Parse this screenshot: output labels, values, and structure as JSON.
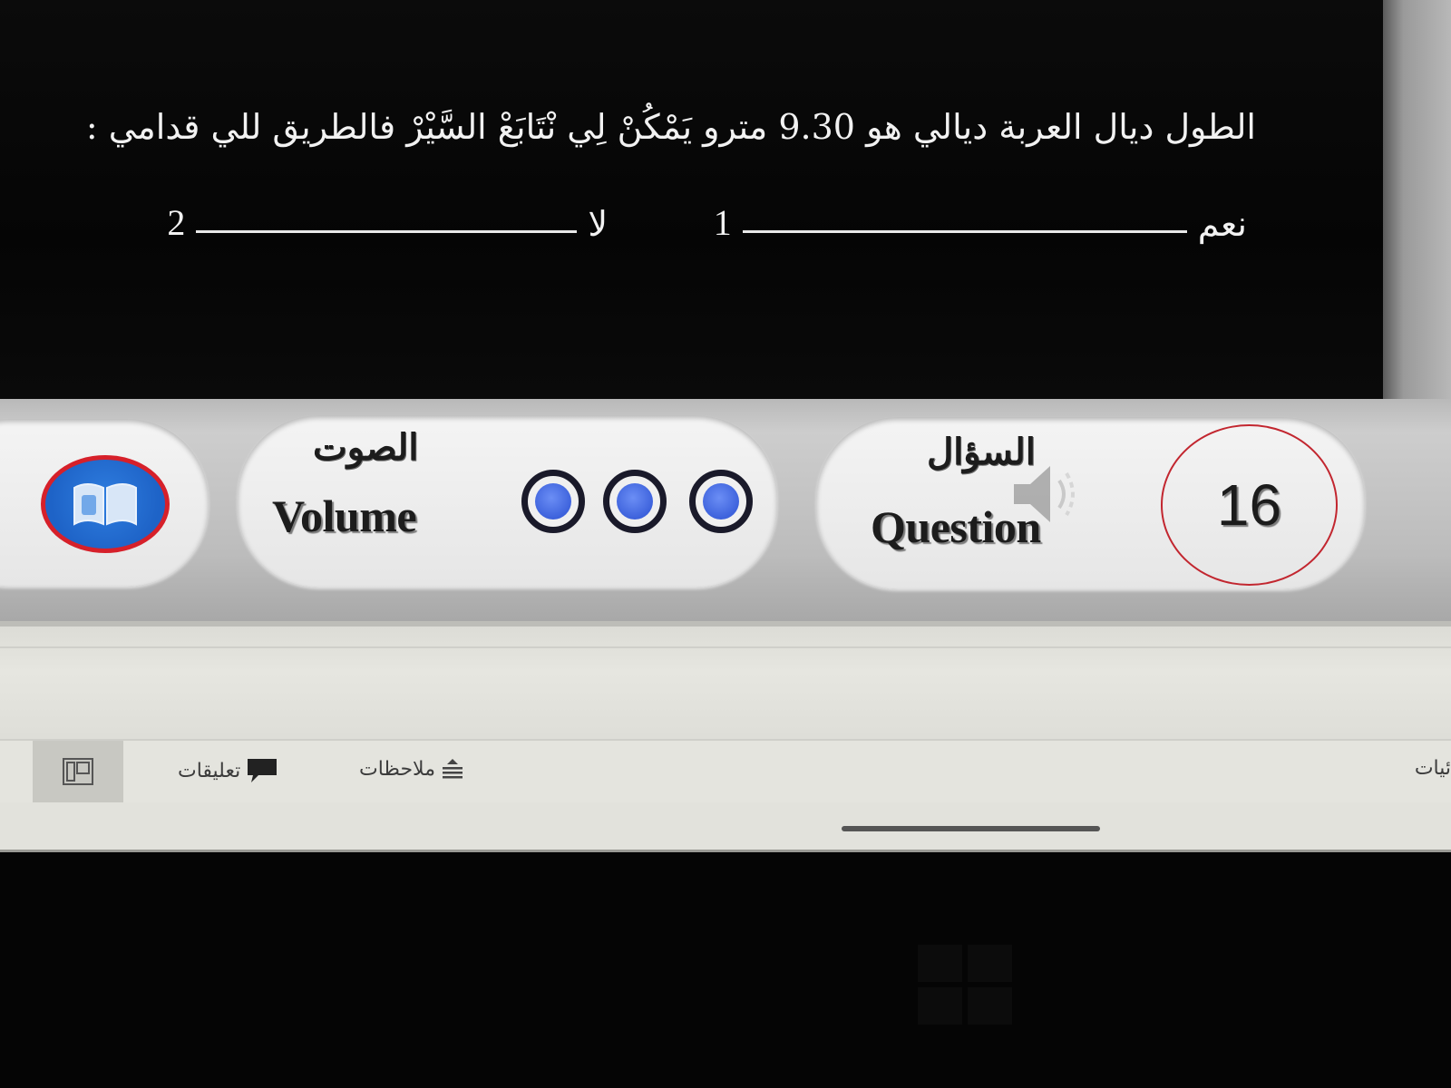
{
  "slide": {
    "question": "الطول ديال العربة ديالي هو 9.30 مترو يَمْكُنْ لِي نْتَابَعْ السَّيْرْ فالطريق للي قدامي :",
    "answers": [
      {
        "label": "نعم",
        "number": "1"
      },
      {
        "label": "لا",
        "number": "2"
      }
    ]
  },
  "controls": {
    "volume_label_ar": "الصوت",
    "volume_label_en": "Volume",
    "volume_levels": 3,
    "question_label_ar": "السؤال",
    "question_label_en": "Question",
    "question_number": "16"
  },
  "status_bar": {
    "comments_label": "تعليقات",
    "notes_label": "ملاحظات",
    "right_partial": "ئيات"
  },
  "colors": {
    "accent_blue": "#2f7ee0",
    "accent_red": "#d6202a",
    "volume_dot": "#3d62dc"
  },
  "icons": {
    "book": "book-icon",
    "speaker": "speaker-icon",
    "comments": "comment-icon",
    "notes": "notes-icon",
    "view": "normal-view-icon",
    "windows": "windows-logo-icon"
  }
}
